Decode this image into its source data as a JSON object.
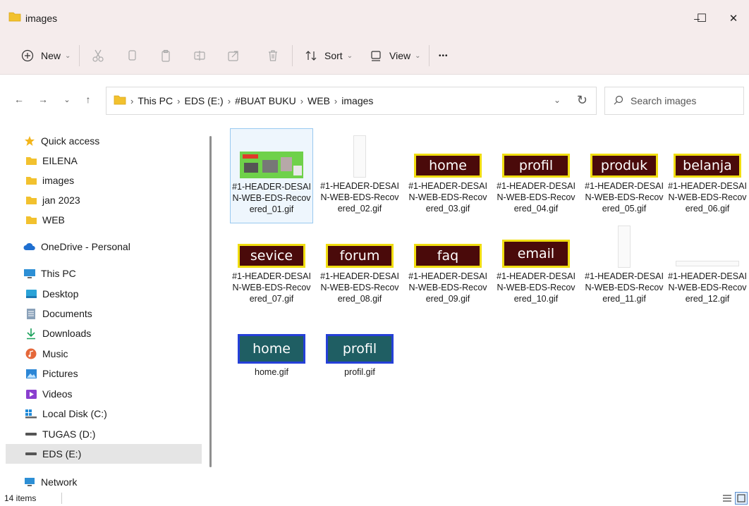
{
  "window": {
    "title": "images",
    "minimize_glyph": "–",
    "maximize_glyph": "☐",
    "close_glyph": "✕"
  },
  "toolbar": {
    "new_label": "New",
    "sort_label": "Sort",
    "view_label": "View",
    "more_glyph": "•••",
    "icons": [
      "plus-circle-icon",
      "cut-icon",
      "copy-icon",
      "paste-icon",
      "rename-icon",
      "share-icon",
      "delete-icon",
      "sort-icon",
      "view-icon",
      "more-icon"
    ]
  },
  "address": {
    "breadcrumbs": [
      "This PC",
      "EDS (E:)",
      "#BUAT BUKU",
      "WEB",
      "images"
    ],
    "search_placeholder": "Search images"
  },
  "sidebar": {
    "quick_access": "Quick access",
    "quick_items": [
      "EILENA",
      "images",
      "jan 2023",
      "WEB"
    ],
    "onedrive": "OneDrive - Personal",
    "this_pc": "This PC",
    "pc_items": [
      "Desktop",
      "Documents",
      "Downloads",
      "Music",
      "Pictures",
      "Videos",
      "Local Disk (C:)",
      "TUGAS (D:)",
      "EDS (E:)"
    ],
    "network": "Network",
    "selected_item": "EDS (E:)"
  },
  "files": [
    {
      "name": "#1-HEADER-DESAIN-WEB-EDS-Recovered_01.gif",
      "thumb_label": ""
    },
    {
      "name": "#1-HEADER-DESAIN-WEB-EDS-Recovered_02.gif",
      "thumb_label": ""
    },
    {
      "name": "#1-HEADER-DESAIN-WEB-EDS-Recovered_03.gif",
      "thumb_label": "home"
    },
    {
      "name": "#1-HEADER-DESAIN-WEB-EDS-Recovered_04.gif",
      "thumb_label": "profil"
    },
    {
      "name": "#1-HEADER-DESAIN-WEB-EDS-Recovered_05.gif",
      "thumb_label": "produk"
    },
    {
      "name": "#1-HEADER-DESAIN-WEB-EDS-Recovered_06.gif",
      "thumb_label": "belanja"
    },
    {
      "name": "#1-HEADER-DESAIN-WEB-EDS-Recovered_07.gif",
      "thumb_label": "sevice"
    },
    {
      "name": "#1-HEADER-DESAIN-WEB-EDS-Recovered_08.gif",
      "thumb_label": "forum"
    },
    {
      "name": "#1-HEADER-DESAIN-WEB-EDS-Recovered_09.gif",
      "thumb_label": "faq"
    },
    {
      "name": "#1-HEADER-DESAIN-WEB-EDS-Recovered_10.gif",
      "thumb_label": "email"
    },
    {
      "name": "#1-HEADER-DESAIN-WEB-EDS-Recovered_11.gif",
      "thumb_label": ""
    },
    {
      "name": "#1-HEADER-DESAIN-WEB-EDS-Recovered_12.gif",
      "thumb_label": ""
    },
    {
      "name": "home.gif",
      "thumb_label": "home"
    },
    {
      "name": "profil.gif",
      "thumb_label": "profil"
    }
  ],
  "status": {
    "item_count": "14 items"
  },
  "colors": {
    "chrome_background": "#f5ecec",
    "folder_yellow": "#f2c12e",
    "button_maroon": "#4a0a0a",
    "button_gold_border": "#f0dd10",
    "button_teal": "#1f5e63",
    "button_blue_border": "#2540d8",
    "selection_blue": "#99c9f0"
  }
}
